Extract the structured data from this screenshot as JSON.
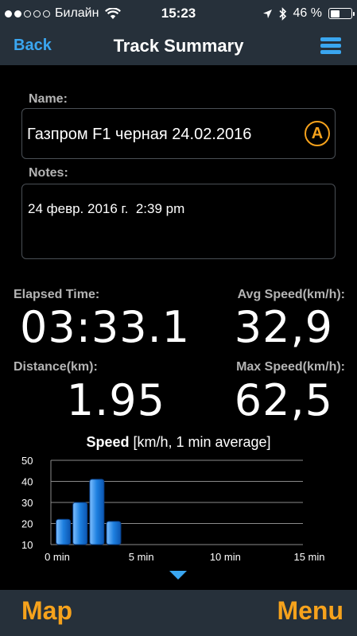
{
  "status_bar": {
    "carrier": "Билайн",
    "time": "15:23",
    "battery": "46 %",
    "battery_level": 0.46,
    "signal_bars": 2
  },
  "nav": {
    "back_label": "Back",
    "title": "Track Summary"
  },
  "name": {
    "label": "Name:",
    "value": "Газпром F1 черная 24.02.2016",
    "icon_letter": "A"
  },
  "notes": {
    "label": "Notes:",
    "value": "24 февр. 2016 г.  2:39 pm"
  },
  "stats": {
    "elapsed_label": "Elapsed Time:",
    "elapsed_value": "03:33.1",
    "avg_label": "Avg Speed(km/h):",
    "avg_value": "32,9",
    "distance_label": "Distance(km):",
    "distance_value": "1.95",
    "max_label": "Max Speed(km/h):",
    "max_value": "62,5"
  },
  "chart_title": {
    "bold": "Speed",
    "rest": " [km/h, 1 min average]"
  },
  "chart_data": {
    "type": "bar",
    "title": "Speed [km/h, 1 min average]",
    "xlabel": "",
    "ylabel": "",
    "x": [
      0,
      1,
      2,
      3
    ],
    "values": [
      22,
      30,
      41,
      21
    ],
    "ylim": [
      10,
      50
    ],
    "xlim": [
      0,
      15
    ],
    "yticks": [
      "10",
      "20",
      "30",
      "40",
      "50"
    ],
    "xticks": [
      "0 min",
      "5 min",
      "10 min",
      "15 min"
    ],
    "xtick_values": [
      0,
      5,
      10,
      15
    ],
    "grid": true,
    "bar_color": "#1e80e0"
  },
  "bottom_bar": {
    "left_label": "Map",
    "right_label": "Menu"
  },
  "colors": {
    "accent_blue": "#3aa6f0",
    "accent_orange": "#f6a21c",
    "bar_background": "#26303a"
  }
}
